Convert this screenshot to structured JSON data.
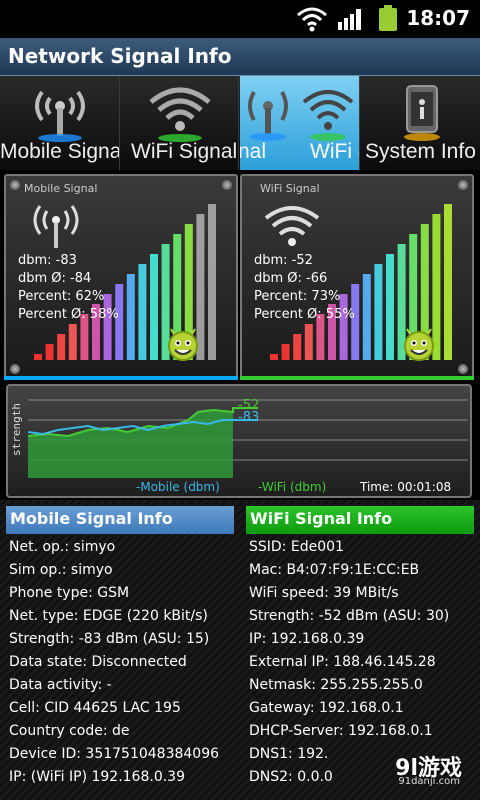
{
  "status_bar": {
    "time": "18:07"
  },
  "app": {
    "title": "Network Signal Info"
  },
  "tabs": [
    {
      "label": "Mobile Signa"
    },
    {
      "label": "WiFi Signal"
    },
    {
      "label": "nal"
    },
    {
      "label": "WiFi &"
    },
    {
      "label": "System Info"
    }
  ],
  "mobile_panel": {
    "title": "Mobile Signal",
    "dbm": "dbm: -83",
    "dbm_avg": "dbm Ø: -84",
    "percent": "Percent: 62%",
    "percent_avg": "Percent Ø: 58%",
    "percent_value": 62
  },
  "wifi_panel": {
    "title": "WiFi Signal",
    "dbm": "dbm: -52",
    "dbm_avg": "dbm Ø: -66",
    "percent": "Percent: 73%",
    "percent_avg": "Percent Ø: 55%",
    "percent_value": 73
  },
  "graph": {
    "ylabel": "strength",
    "legend_mobile": "-Mobile (dbm)",
    "legend_wifi": "-WiFi (dbm)",
    "time": "Time: 00:01:08",
    "label_wifi": "-52",
    "label_mobile": "-83",
    "colors": {
      "mobile": "#3ab8e8",
      "wifi": "#44cc33"
    }
  },
  "mobile_info": {
    "heading": "Mobile Signal Info",
    "items": [
      "Net. op.: simyo",
      "Sim op.: simyo",
      "Phone type: GSM",
      "Net. type: EDGE (220 kBit/s)",
      "Strength: -83 dBm (ASU: 15)",
      "Data state: Disconnected",
      "Data activity: -",
      "Cell: CID 44625 LAC 195",
      "Country code: de",
      "Device ID: 351751048384096",
      "IP: (WiFi IP) 192.168.0.39"
    ]
  },
  "wifi_info": {
    "heading": "WiFi Signal Info",
    "items": [
      "SSID: Ede001",
      "Mac: B4:07:F9:1E:CC:EB",
      "WiFi speed: 39 MBit/s",
      "Strength: -52 dBm (ASU: 30)",
      "IP: 192.168.0.39",
      "External IP: 188.46.145.28",
      "Netmask: 255.255.255.0",
      "Gateway: 192.168.0.1",
      "DHCP-Server: 192.168.0.1",
      "DNS1: 192.",
      "DNS2: 0.0.0"
    ]
  },
  "watermark": {
    "logo": "9l游戏",
    "url": "91danji.com"
  }
}
